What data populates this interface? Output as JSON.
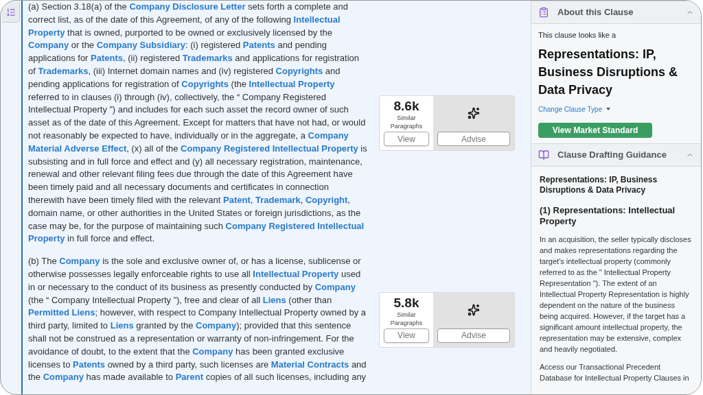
{
  "paragraphs": [
    {
      "text": "(a) Section 3.18(a) of the **Company Disclosure Letter** sets forth a complete and correct list, as of the date of this Agreement, of any of the following **Intellectual Property** that is owned, purported to be owned or exclusively licensed by the **Company** or the **Company Subsidiary**: (i) registered **Patents** and pending applications for **Patents**, (ii) registered **Trademarks** and applications for registration of **Trademarks**, (iii) Internet domain names and (iv) registered **Copyrights** and pending applications for registration of **Copyrights** (the **Intellectual Property** referred to in clauses (i) through (iv), collectively, the “ Company Registered Intellectual Property ”) and includes for each such asset the record owner of such asset as of the date of this Agreement. Except for matters that have not had, or would not reasonably be expected to have, individually or in the aggregate, a **Company Material Adverse Effect**, (x) all of the **Company Registered Intellectual Property** is subsisting and in full force and effect and (y) all necessary registration, maintenance, renewal and other relevant filing fees due through the date of this Agreement have been timely paid and all necessary documents and certificates in connection therewith have been timely filed with the relevant **Patent**, **Trademark**, **Copyright**, domain name, or other authorities in the United States or foreign jurisdictions, as the case may be, for the purpose of maintaining such **Company Registered Intellectual Property** in full force and effect.",
      "count": "8.6k",
      "count_label": "Similar Paragraphs",
      "view": "View",
      "advise": "Advise"
    },
    {
      "text": "(b) The **Company** is the sole and exclusive owner of, or has a license, sublicense or otherwise possesses legally enforceable rights to use all **Intellectual Property** used in or necessary to the conduct of its business as presently conducted by **Company** (the “ Company Intellectual Property ”), free and clear of all **Liens** (other than **Permitted Liens**; however, with respect to Company Intellectual Property owned by a third party, limited to **Liens** granted by the **Company**); provided that this sentence shall not be construed as a representation or warranty of non-infringement. For the avoidance of doubt, to the extent that the **Company** has been granted exclusive licenses to **Patents** owned by a third party, such licenses are **Material Contracts** and the **Company** has made available to **Parent** copies of all such licenses, including any",
      "count": "5.8k",
      "count_label": "Similar Paragraphs",
      "view": "View",
      "advise": "Advise"
    }
  ],
  "about": {
    "title": "About this Clause",
    "expanded": true,
    "intro": "This clause looks like a",
    "clause_type": "Representations: IP, Business Disruptions & Data Privacy",
    "change_link": "Change Clause Type",
    "button": "View Market Standard"
  },
  "guidance": {
    "title": "Clause Drafting Guidance",
    "expanded": true,
    "heading": "Representations: IP, Business Disruptions & Data Privacy",
    "subheading": "(1) Representations: Intellectual Property",
    "body": [
      "In an acquisition, the seller typically discloses and makes representations regarding the target's intellectual property (commonly referred to as the \" Intellectual Property Representation \"). The extent of an Intellectual Property Representation is highly dependent on the nature of the business being acquired. However, if the target has a significant amount intellectual property, the representation may be extensive, complex and heavily negotiated.",
      "Access our Transactional Precedent Database for Intellectual Property Clauses in"
    ]
  }
}
